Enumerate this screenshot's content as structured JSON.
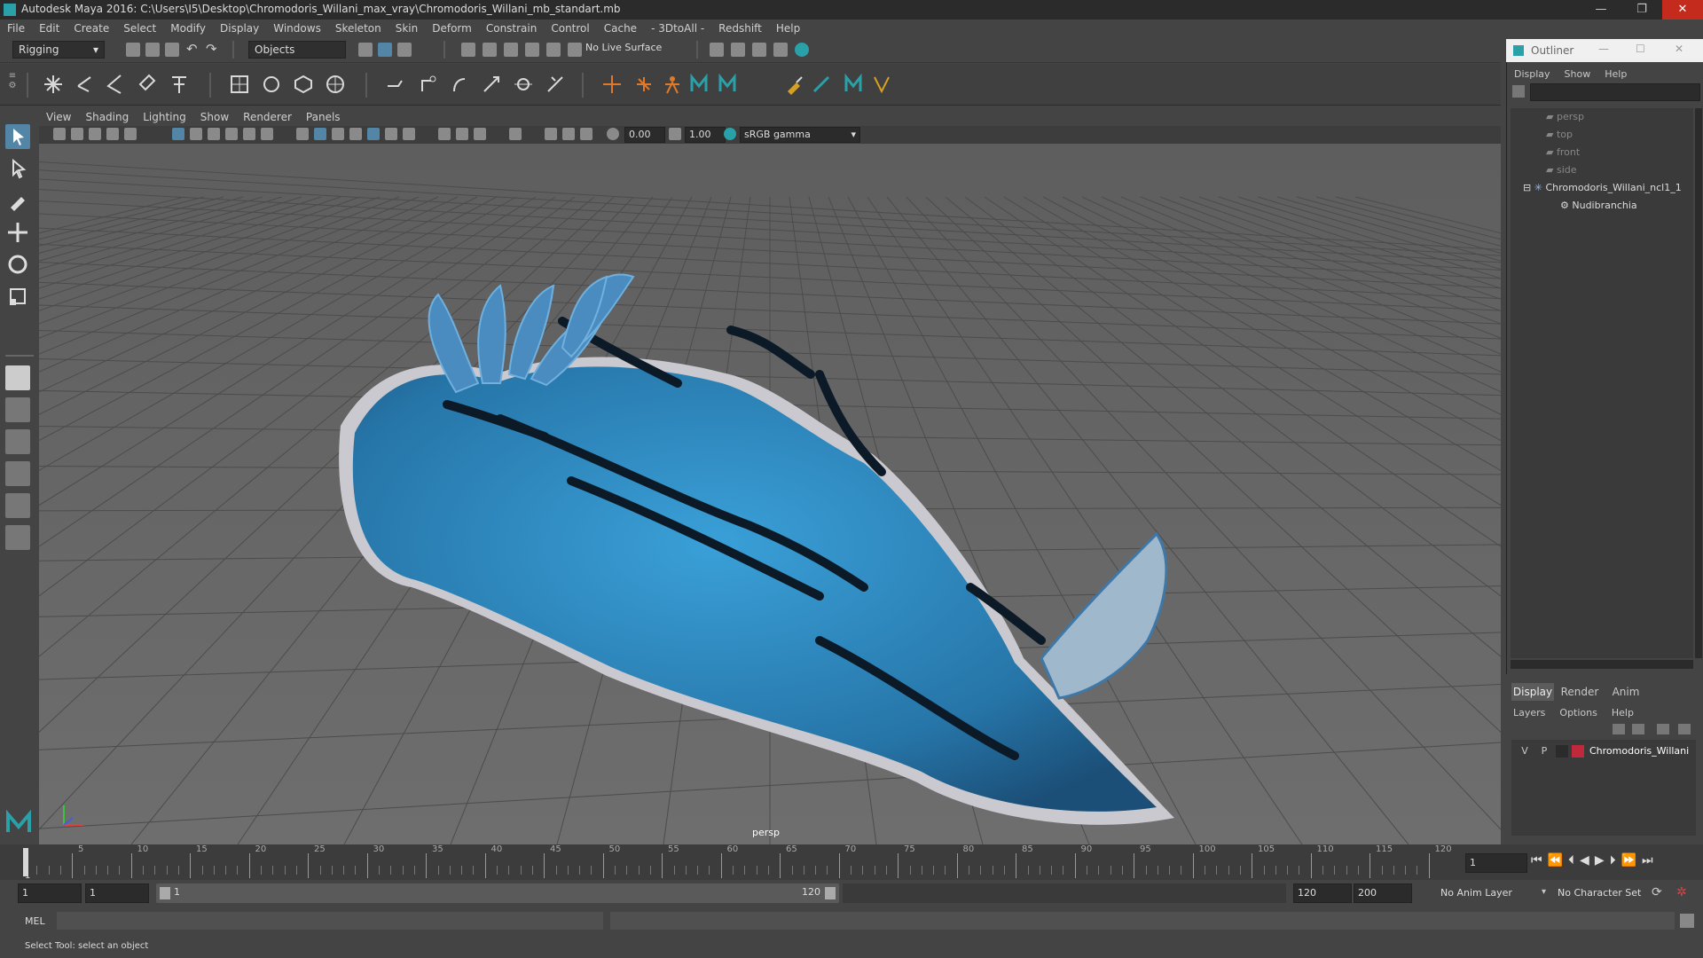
{
  "window": {
    "title": "Autodesk Maya 2016: C:\\Users\\I5\\Desktop\\Chromodoris_Willani_max_vray\\Chromodoris_Willani_mb_standart.mb",
    "minimize": "—",
    "restore": "❐",
    "close": "✕"
  },
  "menubar": [
    "File",
    "Edit",
    "Create",
    "Select",
    "Modify",
    "Display",
    "Windows",
    "Skeleton",
    "Skin",
    "Deform",
    "Constrain",
    "Control",
    "Cache",
    "- 3DtoAll -",
    "Redshift",
    "Help"
  ],
  "statusline": {
    "menuset": "Rigging",
    "selection_mode": "Objects",
    "live_surface": "No Live Surface"
  },
  "viewport": {
    "menu": [
      "View",
      "Shading",
      "Lighting",
      "Show",
      "Renderer",
      "Panels"
    ],
    "exposure": "0.00",
    "gamma": "1.00",
    "color_space": "sRGB gamma",
    "camera_label": "persp"
  },
  "outliner": {
    "title": "Outliner",
    "menu": [
      "Display",
      "Show",
      "Help"
    ],
    "items": [
      {
        "label": "persp",
        "dim": true
      },
      {
        "label": "top",
        "dim": true
      },
      {
        "label": "front",
        "dim": true
      },
      {
        "label": "side",
        "dim": true
      },
      {
        "label": "Chromodoris_Willani_ncl1_1",
        "dim": false
      },
      {
        "label": "Nudibranchia",
        "dim": false
      }
    ]
  },
  "layers": {
    "tabs": [
      "Display",
      "Render",
      "Anim"
    ],
    "menu": [
      "Layers",
      "Options",
      "Help"
    ],
    "row": {
      "v": "V",
      "p": "P",
      "name": "Chromodoris_Willani",
      "color": "#c0283c"
    }
  },
  "timeline": {
    "ticks": [
      "5",
      "10",
      "15",
      "20",
      "25",
      "30",
      "35",
      "40",
      "45",
      "50",
      "55",
      "60",
      "65",
      "70",
      "75",
      "80",
      "85",
      "90",
      "95",
      "100",
      "105",
      "110",
      "115",
      "120"
    ],
    "current_frame": "1",
    "current_marker": "1"
  },
  "range": {
    "start": "1",
    "inner_start": "1",
    "slider_start": "1",
    "slider_end": "120",
    "end": "120",
    "outer_end": "200",
    "anim_layer": "No Anim Layer",
    "character_set": "No Character Set"
  },
  "command": {
    "label": "MEL"
  },
  "help_line": "Select Tool: select an object",
  "colors": {
    "accent": "#5285a6",
    "maya_teal": "#2aa0a8",
    "nudibranch": "#2d7fb8"
  }
}
